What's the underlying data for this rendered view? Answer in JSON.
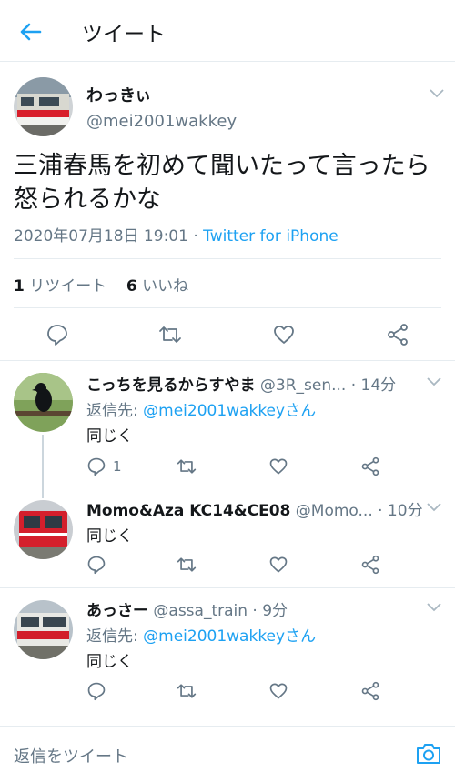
{
  "header": {
    "title": "ツイート",
    "back_icon": "arrow-left-icon",
    "accent": "#1da1f2"
  },
  "tweet": {
    "display_name": "わっきぃ",
    "handle": "@mei2001wakkey",
    "text_line1": "三浦春馬を初めて聞いたって言ったら",
    "text_line2": "怒られるかな",
    "timestamp": "2020年07月18日 19:01",
    "separator": " · ",
    "source": "Twitter for iPhone",
    "retweet_count": "1",
    "retweet_label": "リツイート",
    "like_count": "6",
    "like_label": "いいね"
  },
  "replies": [
    {
      "display_name": "こっちを見るからすやま",
      "meta": " @3R_sen... · 14分",
      "reply_to_prefix": "返信先: ",
      "reply_to_handle": "@mei2001wakkeyさん",
      "text": "同じく",
      "reply_count": "1"
    },
    {
      "display_name": "Momo&Aza KC14&CE08",
      "meta": " @Momo... · 10分",
      "text": "同じく"
    },
    {
      "display_name": "あっさー",
      "meta": " @assa_train · 9分",
      "reply_to_prefix": "返信先: ",
      "reply_to_handle": "@mei2001wakkeyさん",
      "text": "同じく"
    }
  ],
  "composer": {
    "placeholder": "返信をツイート",
    "camera_icon": "camera-icon"
  },
  "colors": {
    "link": "#1da1f2",
    "muted": "#657786",
    "text": "#14171a",
    "divider": "#e6ecf0"
  }
}
